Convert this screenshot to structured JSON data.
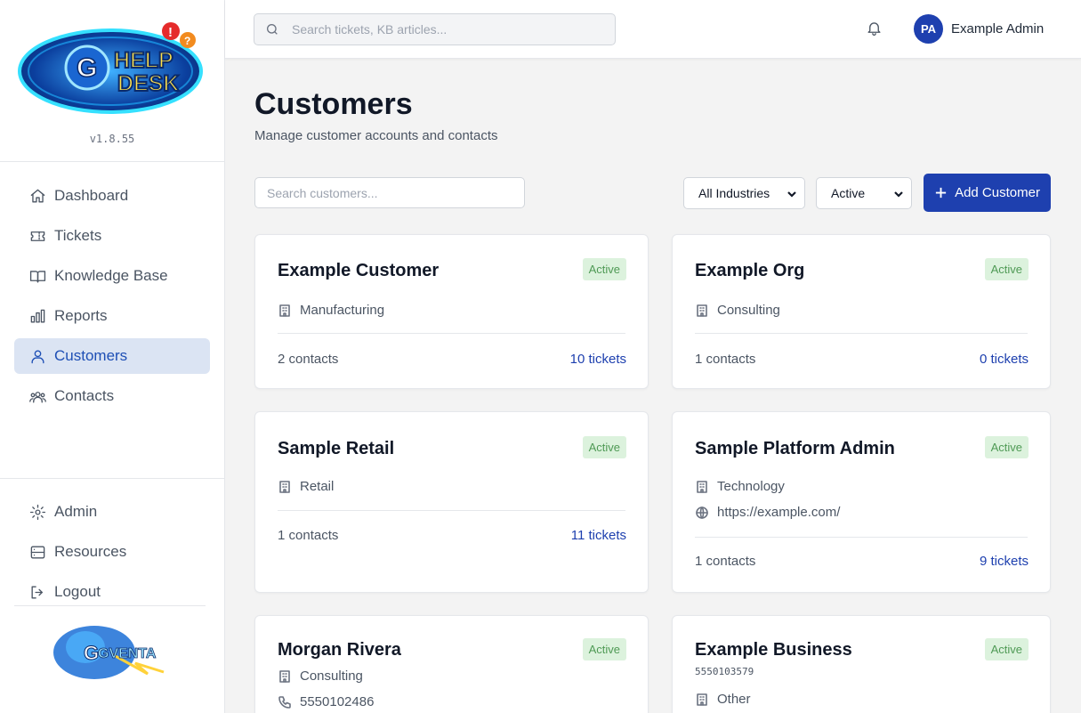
{
  "app": {
    "version": "v1.8.55",
    "logo_text": "HELP DESK",
    "bottom_logo_text": "GVENTA"
  },
  "colors": {
    "primary": "#1e40af",
    "active_nav_bg": "#dbe4f3",
    "badge_bg": "#dcf2dd",
    "badge_text": "#4f9a55"
  },
  "sidebar": {
    "items": [
      {
        "label": "Dashboard",
        "icon": "home-icon"
      },
      {
        "label": "Tickets",
        "icon": "ticket-icon"
      },
      {
        "label": "Knowledge Base",
        "icon": "book-icon"
      },
      {
        "label": "Reports",
        "icon": "bar-chart-icon"
      },
      {
        "label": "Customers",
        "icon": "users-icon",
        "active": true
      },
      {
        "label": "Contacts",
        "icon": "contacts-icon"
      }
    ],
    "bottom_items": [
      {
        "label": "Admin",
        "icon": "gear-icon"
      },
      {
        "label": "Resources",
        "icon": "server-icon"
      },
      {
        "label": "Logout",
        "icon": "logout-icon"
      }
    ]
  },
  "header": {
    "search_placeholder": "Search tickets, KB articles...",
    "avatar_initials": "PA",
    "user_name": "Example Admin"
  },
  "page": {
    "title": "Customers",
    "subtitle": "Manage customer accounts and contacts",
    "search_placeholder": "Search customers...",
    "industry_filter": "All Industries",
    "status_filter": "Active",
    "add_button": "Add Customer"
  },
  "customers": [
    {
      "name": "Example Customer",
      "status": "Active",
      "industry": "Manufacturing",
      "contacts": "2 contacts",
      "tickets": "10 tickets"
    },
    {
      "name": "Example Org",
      "status": "Active",
      "industry": "Consulting",
      "contacts": "1 contacts",
      "tickets": "0 tickets"
    },
    {
      "name": "Sample Retail",
      "status": "Active",
      "industry": "Retail",
      "contacts": "1 contacts",
      "tickets": "11 tickets"
    },
    {
      "name": "Sample Platform Admin",
      "status": "Active",
      "industry": "Technology",
      "website": "https://example.com/",
      "contacts": "1 contacts",
      "tickets": "9 tickets"
    },
    {
      "name": "Morgan Rivera",
      "status": "Active",
      "industry": "Consulting",
      "phone": "5550102486"
    },
    {
      "name": "Example Business",
      "status": "Active",
      "phone_small": "5550103579",
      "industry": "Other"
    }
  ]
}
